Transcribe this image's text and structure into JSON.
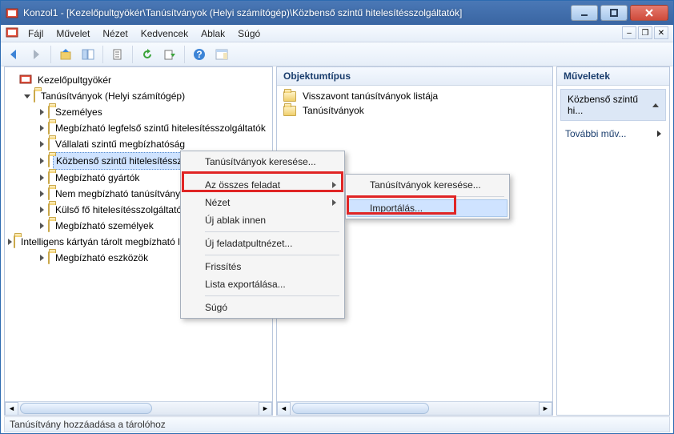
{
  "window": {
    "title": "Konzol1 - [Kezelőpultgyökér\\Tanúsítványok (Helyi számítógép)\\Közbenső szintű hitelesítésszolgáltatók]"
  },
  "menubar": {
    "items": [
      "Fájl",
      "Művelet",
      "Nézet",
      "Kedvencek",
      "Ablak",
      "Súgó"
    ]
  },
  "tree": {
    "root": "Kezelőpultgyökér",
    "cert_root": "Tanúsítványok (Helyi számítógép)",
    "children": [
      "Személyes",
      "Megbízható legfelső szintű hitelesítésszolgáltatók",
      "Vállalati szintű megbízhatóság",
      "Közbenső szintű hitelesítésszolgáltatók",
      "Megbízható gyártók",
      "Nem megbízható tanúsítványok",
      "Külső fő hitelesítésszolgáltatók",
      "Megbízható személyek",
      "Intelligens kártyán tárolt megbízható legfelső szintű tanúsítványok",
      "Megbízható eszközök"
    ],
    "selected_index": 3
  },
  "center": {
    "header": "Objektumtípus",
    "items": [
      "Visszavont tanúsítványok listája",
      "Tanúsítványok"
    ]
  },
  "actions": {
    "header": "Műveletek",
    "section_title": "Közbenső szintű hi...",
    "more": "További műv..."
  },
  "context_menu": {
    "items": [
      {
        "label": "Tanúsítványok keresése...",
        "sepAfter": true
      },
      {
        "label": "Az összes feladat",
        "arrow": true,
        "highlight": true
      },
      {
        "label": "Nézet",
        "arrow": true
      },
      {
        "label": "Új ablak innen",
        "sepAfter": true
      },
      {
        "label": "Új feladatpultnézet...",
        "sepAfter": true
      },
      {
        "label": "Frissítés"
      },
      {
        "label": "Lista exportálása...",
        "sepAfter": true
      },
      {
        "label": "Súgó"
      }
    ]
  },
  "submenu": {
    "items": [
      {
        "label": "Tanúsítványok keresése..."
      },
      {
        "label": "Importálás...",
        "highlight": true,
        "hover": true
      }
    ]
  },
  "statusbar": {
    "text": "Tanúsítvány hozzáadása a tárolóhoz"
  }
}
